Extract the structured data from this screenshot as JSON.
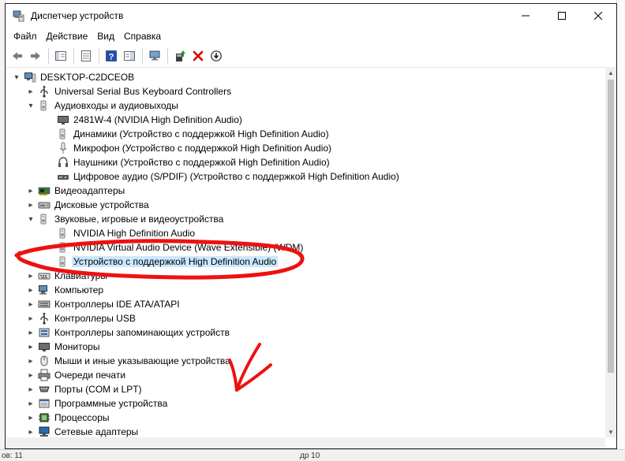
{
  "window": {
    "title": "Диспетчер устройств",
    "controls": {
      "minimize": "—",
      "maximize": "☐",
      "close": "✕"
    }
  },
  "menu": [
    "Файл",
    "Действие",
    "Вид",
    "Справка"
  ],
  "tree": {
    "root": "DESKTOP-C2DCEOB",
    "items": [
      {
        "label": "Universal Serial Bus Keyboard Controllers",
        "level": 1,
        "toggle": "▸",
        "icon": "usb-icon"
      },
      {
        "label": "Аудиовходы и аудиовыходы",
        "level": 1,
        "toggle": "▾",
        "icon": "speaker-icon"
      },
      {
        "label": "2481W-4 (NVIDIA High Definition Audio)",
        "level": 2,
        "toggle": "",
        "icon": "monitor-icon"
      },
      {
        "label": "Динамики (Устройство с поддержкой High Definition Audio)",
        "level": 2,
        "toggle": "",
        "icon": "speaker-icon"
      },
      {
        "label": "Микрофон (Устройство с поддержкой High Definition Audio)",
        "level": 2,
        "toggle": "",
        "icon": "microphone-icon"
      },
      {
        "label": "Наушники (Устройство с поддержкой High Definition Audio)",
        "level": 2,
        "toggle": "",
        "icon": "headphones-icon"
      },
      {
        "label": "Цифровое аудио (S/PDIF) (Устройство с поддержкой High Definition Audio)",
        "level": 2,
        "toggle": "",
        "icon": "digital-audio-icon"
      },
      {
        "label": "Видеоадаптеры",
        "level": 1,
        "toggle": "▸",
        "icon": "display-adapter-icon"
      },
      {
        "label": "Дисковые устройства",
        "level": 1,
        "toggle": "▸",
        "icon": "disk-drive-icon"
      },
      {
        "label": "Звуковые, игровые и видеоустройства",
        "level": 1,
        "toggle": "▾",
        "icon": "speaker-icon"
      },
      {
        "label": "NVIDIA High Definition Audio",
        "level": 2,
        "toggle": "",
        "icon": "speaker-icon"
      },
      {
        "label": "NVIDIA Virtual Audio Device (Wave Extensible) (WDM)",
        "level": 2,
        "toggle": "",
        "icon": "speaker-icon"
      },
      {
        "label": "Устройство с поддержкой High Definition Audio",
        "level": 2,
        "toggle": "",
        "icon": "speaker-icon",
        "selected": true
      },
      {
        "label": "Клавиатуры",
        "level": 1,
        "toggle": "▸",
        "icon": "keyboard-icon"
      },
      {
        "label": "Компьютер",
        "level": 1,
        "toggle": "▸",
        "icon": "computer-icon"
      },
      {
        "label": "Контроллеры IDE ATA/ATAPI",
        "level": 1,
        "toggle": "▸",
        "icon": "ide-controller-icon"
      },
      {
        "label": "Контроллеры USB",
        "level": 1,
        "toggle": "▸",
        "icon": "usb-icon"
      },
      {
        "label": "Контроллеры запоминающих устройств",
        "level": 1,
        "toggle": "▸",
        "icon": "storage-controller-icon"
      },
      {
        "label": "Мониторы",
        "level": 1,
        "toggle": "▸",
        "icon": "monitor-icon"
      },
      {
        "label": "Мыши и иные указывающие устройства",
        "level": 1,
        "toggle": "▸",
        "icon": "mouse-icon"
      },
      {
        "label": "Очереди печати",
        "level": 1,
        "toggle": "▸",
        "icon": "printer-icon"
      },
      {
        "label": "Порты (COM и LPT)",
        "level": 1,
        "toggle": "▸",
        "icon": "port-icon"
      },
      {
        "label": "Программные устройства",
        "level": 1,
        "toggle": "▸",
        "icon": "software-device-icon"
      },
      {
        "label": "Процессоры",
        "level": 1,
        "toggle": "▸",
        "icon": "processor-icon"
      },
      {
        "label": "Сетевые адаптеры",
        "level": 1,
        "toggle": "▸",
        "icon": "network-adapter-icon"
      }
    ]
  },
  "background": {
    "status_left": "ов: 11",
    "status_mid": "др 10"
  },
  "colors": {
    "selection": "#cce8ff",
    "annotation_red": "#ee1111",
    "close_x_red": "#d40000",
    "help_blue": "#1f4fb4"
  }
}
